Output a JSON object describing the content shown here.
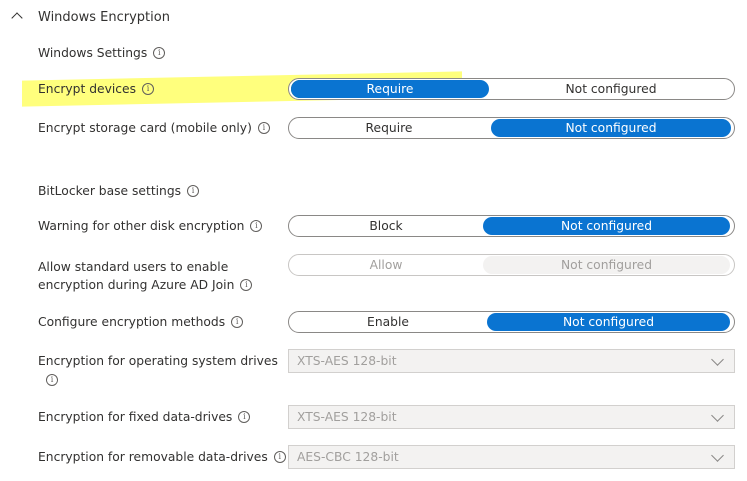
{
  "section": {
    "title": "Windows Encryption",
    "icon": "chevron-up-icon"
  },
  "windows_settings": {
    "heading": "Windows Settings"
  },
  "rows": {
    "encrypt_devices": {
      "label": "Encrypt devices",
      "options": [
        "Require",
        "Not configured"
      ],
      "selected": "Require"
    },
    "encrypt_storage_card": {
      "label": "Encrypt storage card (mobile only)",
      "options": [
        "Require",
        "Not configured"
      ],
      "selected": "Not configured"
    },
    "warning_other_disk": {
      "label": "Warning for other disk encryption",
      "options": [
        "Block",
        "Not configured"
      ],
      "selected": "Not configured"
    },
    "allow_standard_users": {
      "label_line1": "Allow standard users to enable",
      "label_line2": "encryption during Azure AD Join",
      "options": [
        "Allow",
        "Not configured"
      ],
      "selected": "Not configured",
      "disabled": true
    },
    "configure_methods": {
      "label": "Configure encryption methods",
      "options": [
        "Enable",
        "Not configured"
      ],
      "selected": "Not configured"
    }
  },
  "bitlocker": {
    "heading": "BitLocker base settings"
  },
  "dropdowns": {
    "os_drives": {
      "label": "Encryption for operating system drives",
      "value": "XTS-AES 128-bit"
    },
    "fixed_drives": {
      "label": "Encryption for fixed data-drives",
      "value": "XTS-AES 128-bit"
    },
    "removable_drives": {
      "label": "Encryption for removable data-drives",
      "value": "AES-CBC 128-bit"
    }
  },
  "info_glyph": "i",
  "colors": {
    "selected": "#0a74d1",
    "highlight": "#ffff66",
    "marker": "#1f7f0f"
  }
}
